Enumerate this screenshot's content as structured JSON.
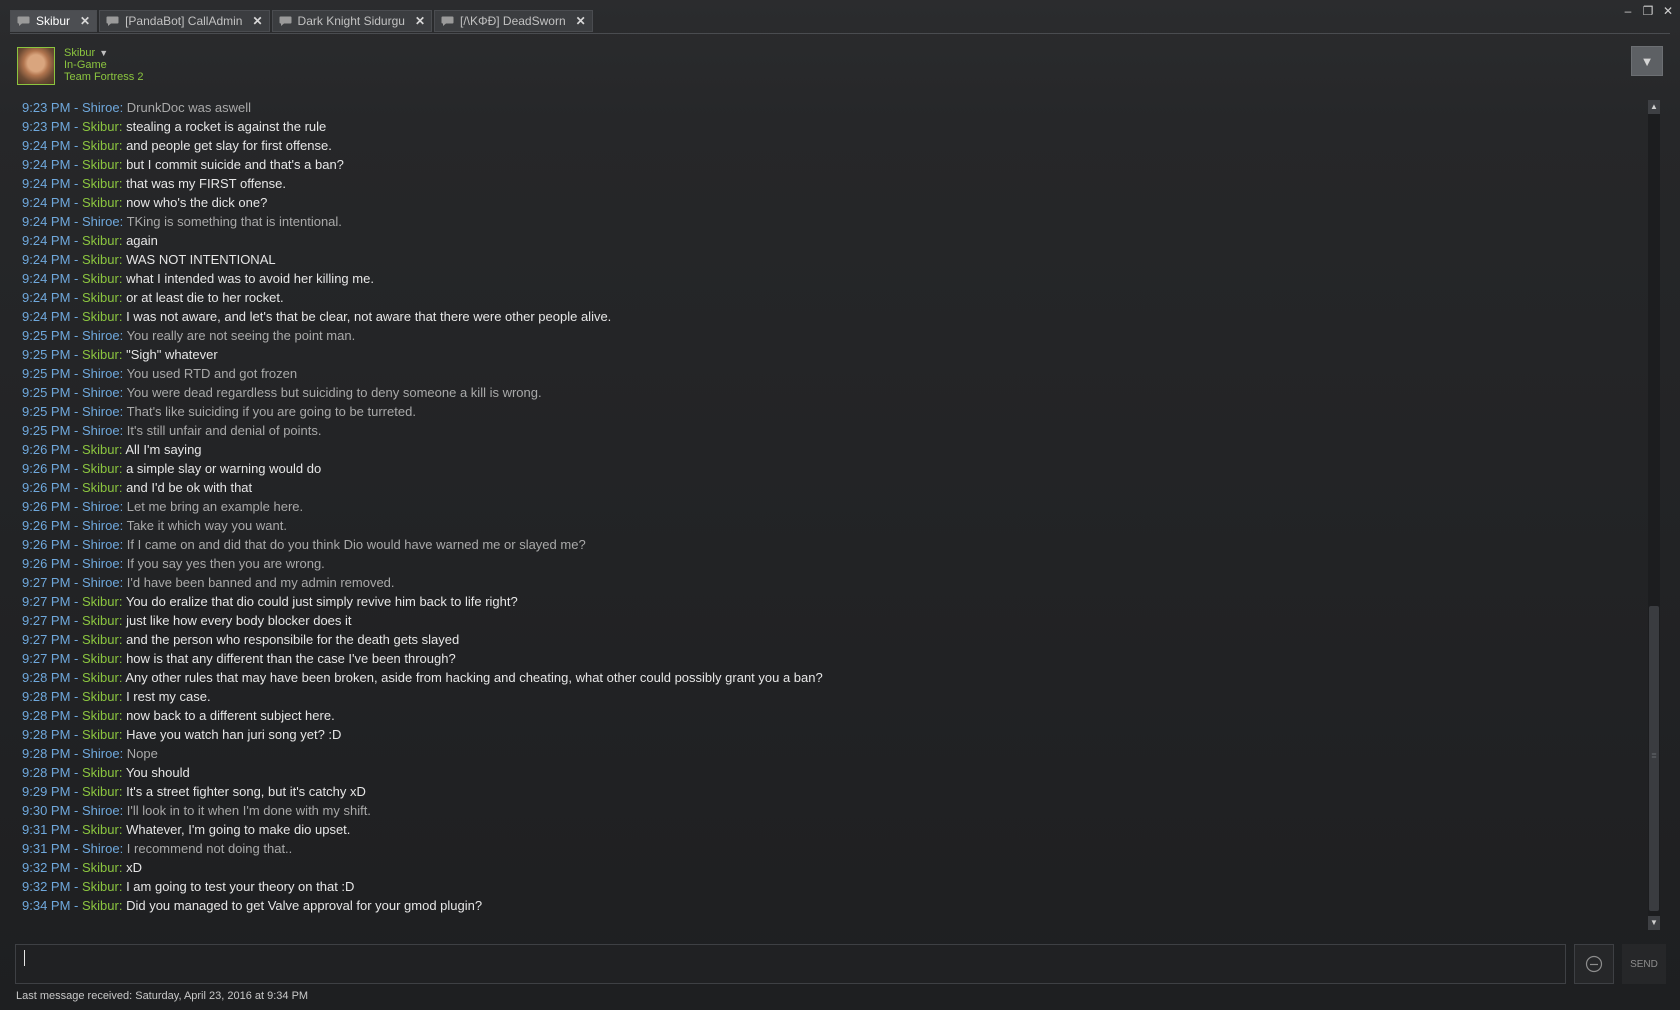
{
  "tabs": [
    {
      "label": "Skibur",
      "active": true
    },
    {
      "label": "[PandaBot] CallAdmin",
      "active": false
    },
    {
      "label": "Dark Knight Sidurgu",
      "active": false
    },
    {
      "label": "[/\\KΦÐ] DeadSworn",
      "active": false
    }
  ],
  "window_controls": {
    "minimize": "–",
    "restore": "❐",
    "close": "✕"
  },
  "header": {
    "username": "Skibur",
    "status": "In-Game",
    "game": "Team Fortress 2"
  },
  "colors": {
    "friend_name": "#8bc53f",
    "self_name": "#6fa8dc",
    "timestamp": "#6fa8dc"
  },
  "messages": [
    {
      "time": "9:23 PM",
      "sender": "Shiroe",
      "text": "DrunkDoc was aswell"
    },
    {
      "time": "9:23 PM",
      "sender": "Skibur",
      "text": "stealing a rocket is against the rule"
    },
    {
      "time": "9:24 PM",
      "sender": "Skibur",
      "text": "and people get slay for first offense."
    },
    {
      "time": "9:24 PM",
      "sender": "Skibur",
      "text": "but I commit suicide and that's a ban?"
    },
    {
      "time": "9:24 PM",
      "sender": "Skibur",
      "text": "that was my FIRST offense."
    },
    {
      "time": "9:24 PM",
      "sender": "Skibur",
      "text": "now who's the dick one?"
    },
    {
      "time": "9:24 PM",
      "sender": "Shiroe",
      "text": "TKing is something that is intentional."
    },
    {
      "time": "9:24 PM",
      "sender": "Skibur",
      "text": "again"
    },
    {
      "time": "9:24 PM",
      "sender": "Skibur",
      "text": "WAS NOT INTENTIONAL"
    },
    {
      "time": "9:24 PM",
      "sender": "Skibur",
      "text": "what I intended was to avoid her killing me."
    },
    {
      "time": "9:24 PM",
      "sender": "Skibur",
      "text": "or at least die to her rocket."
    },
    {
      "time": "9:24 PM",
      "sender": "Skibur",
      "text": "I was not aware, and let's that be clear, not aware that there were other people alive."
    },
    {
      "time": "9:25 PM",
      "sender": "Shiroe",
      "text": "You really are not seeing the point man."
    },
    {
      "time": "9:25 PM",
      "sender": "Skibur",
      "text": "\"Sigh\" whatever"
    },
    {
      "time": "9:25 PM",
      "sender": "Shiroe",
      "text": "You used RTD and got frozen"
    },
    {
      "time": "9:25 PM",
      "sender": "Shiroe",
      "text": "You were dead regardless but suiciding to deny someone a kill is wrong."
    },
    {
      "time": "9:25 PM",
      "sender": "Shiroe",
      "text": "That's like suiciding if you are going to be turreted."
    },
    {
      "time": "9:25 PM",
      "sender": "Shiroe",
      "text": "It's still unfair and denial of points."
    },
    {
      "time": "9:26 PM",
      "sender": "Skibur",
      "text": "All I'm saying"
    },
    {
      "time": "9:26 PM",
      "sender": "Skibur",
      "text": "a simple slay or warning would do"
    },
    {
      "time": "9:26 PM",
      "sender": "Skibur",
      "text": "and I'd be ok with that"
    },
    {
      "time": "9:26 PM",
      "sender": "Shiroe",
      "text": "Let me bring an example here."
    },
    {
      "time": "9:26 PM",
      "sender": "Shiroe",
      "text": "Take it which way you want."
    },
    {
      "time": "9:26 PM",
      "sender": "Shiroe",
      "text": "If I came on and did that do you think Dio would have warned me or slayed me?"
    },
    {
      "time": "9:26 PM",
      "sender": "Shiroe",
      "text": "If you say yes then you are wrong."
    },
    {
      "time": "9:27 PM",
      "sender": "Shiroe",
      "text": "I'd have been banned and my admin removed."
    },
    {
      "time": "9:27 PM",
      "sender": "Skibur",
      "text": "You do eralize that dio could just simply revive him back to life right?"
    },
    {
      "time": "9:27 PM",
      "sender": "Skibur",
      "text": "just like how every body blocker does it"
    },
    {
      "time": "9:27 PM",
      "sender": "Skibur",
      "text": "and the person who responsibile for the death gets slayed"
    },
    {
      "time": "9:27 PM",
      "sender": "Skibur",
      "text": "how is that any different than the case I've been through?"
    },
    {
      "time": "9:28 PM",
      "sender": "Skibur",
      "text": "Any other rules that may have been broken, aside from hacking and cheating, what other could possibly grant you a ban?"
    },
    {
      "time": "9:28 PM",
      "sender": "Skibur",
      "text": "I rest my case."
    },
    {
      "time": "9:28 PM",
      "sender": "Skibur",
      "text": "now back to a different subject here."
    },
    {
      "time": "9:28 PM",
      "sender": "Skibur",
      "text": "Have you watch han juri song yet? :D"
    },
    {
      "time": "9:28 PM",
      "sender": "Shiroe",
      "text": "Nope"
    },
    {
      "time": "9:28 PM",
      "sender": "Skibur",
      "text": "You should"
    },
    {
      "time": "9:29 PM",
      "sender": "Skibur",
      "text": "It's a street fighter song, but it's catchy xD"
    },
    {
      "time": "9:30 PM",
      "sender": "Shiroe",
      "text": "I'll look in to it when I'm done with my shift."
    },
    {
      "time": "9:31 PM",
      "sender": "Skibur",
      "text": "Whatever, I'm going to make dio upset."
    },
    {
      "time": "9:31 PM",
      "sender": "Shiroe",
      "text": "I recommend not doing that.."
    },
    {
      "time": "9:32 PM",
      "sender": "Skibur",
      "text": "xD"
    },
    {
      "time": "9:32 PM",
      "sender": "Skibur",
      "text": "I am going to test your theory on that :D"
    },
    {
      "time": "9:34 PM",
      "sender": "Skibur",
      "text": "Did you managed to get Valve approval for your gmod plugin?"
    }
  ],
  "separator": " - ",
  "input": {
    "value": "",
    "placeholder": ""
  },
  "buttons": {
    "send": "SEND",
    "emoticon_icon": "emoticon-icon"
  },
  "footer": {
    "last_message": "Last message received: Saturday, April 23, 2016 at 9:34 PM"
  }
}
